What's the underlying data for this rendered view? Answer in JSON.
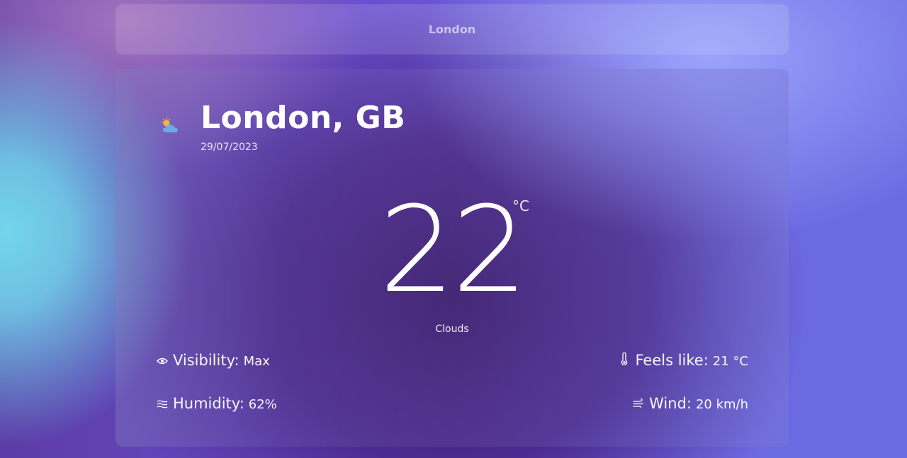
{
  "search": {
    "value": "London",
    "placeholder": ""
  },
  "weather": {
    "icon": "partly-cloudy-icon",
    "city": "London, GB",
    "date": "29/07/2023",
    "temperature": "22",
    "unit": "°C",
    "condition": "Clouds"
  },
  "stats": {
    "visibility": {
      "icon": "eye-icon",
      "label": "Visibility:",
      "value": "Max"
    },
    "humidity": {
      "icon": "humidity-icon",
      "label": "Humidity:",
      "value": "62%"
    },
    "feels_like": {
      "icon": "thermometer-icon",
      "label": "Feels like:",
      "value": "21 °C"
    },
    "wind": {
      "icon": "wind-icon",
      "label": "Wind:",
      "value": "20 km/h"
    }
  },
  "colors": {
    "accent": "#3a1b6e",
    "text": "#ffffff",
    "sky": "#72d6ec"
  }
}
